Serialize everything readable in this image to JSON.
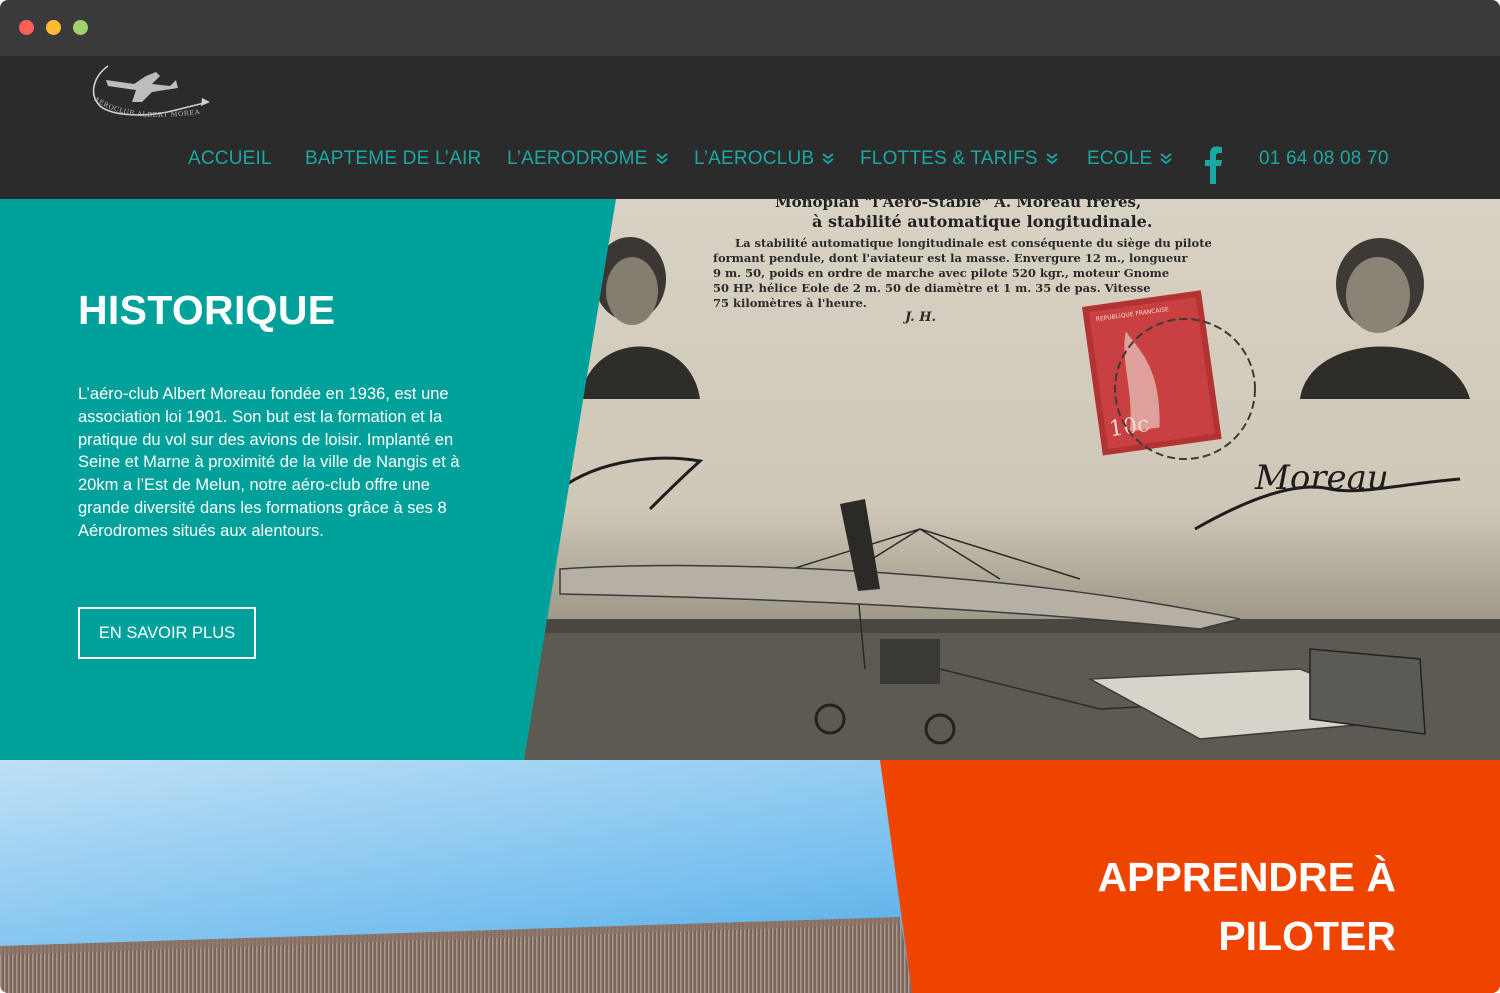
{
  "nav": {
    "items": [
      {
        "label": "ACCUEIL",
        "dropdown": false
      },
      {
        "label": "BAPTEME DE L’AIR",
        "dropdown": false
      },
      {
        "label": "L’AERODROME",
        "dropdown": true
      },
      {
        "label": "L’AEROCLUB",
        "dropdown": true
      },
      {
        "label": "FLOTTES & TARIFS",
        "dropdown": true
      },
      {
        "label": "ECOLE",
        "dropdown": true
      }
    ],
    "social_icon": "facebook-icon",
    "phone": "01 64 08 08 70"
  },
  "logo": {
    "text": "AEROCLUB ALBERT MOREAU"
  },
  "historique": {
    "title": "HISTORIQUE",
    "body": "L’aéro-club Albert Moreau fondée en 1936, est une association loi 1901. Son but est la formation et la pratique du vol sur des avions de loisir. Implanté en Seine et Marne à proximité de la ville de Nangis et à 20km a l’Est de Melun, notre aéro-club offre une grande diversité dans les formations grâce à ses 8 Aérodromes situés aux alentours.",
    "button_label": "EN SAVOIR PLUS",
    "postcard": {
      "headline_1": "Monoplan \"l'Aéro-Stable\" A. Moreau frères,",
      "headline_2": "à stabilité automatique longitudinale.",
      "caption": "La stabilité automatique longitudinale est conséquente du siège du pilote formant pendule, dont l'aviateur est la masse. Envergure 12 m., longueur 9 m. 50, poids en ordre de marche avec pilote 520 kgr., moteur Gnome 50 HP. hélice Eole de 2 m. 50 de diamètre et 1 m. 35 de pas. Vitesse 75 kilomètres à l'heure.",
      "initials": "J. H.",
      "stamp_value": "10c",
      "stamp_text": "REPUBLIQUE FRANCAISE",
      "signature": "Moreau"
    }
  },
  "piloter": {
    "title_line1": "APPRENDRE À",
    "title_line2": "PILOTER"
  },
  "colors": {
    "chrome": "#3a3a3a",
    "header": "#2b2b2b",
    "nav_text": "#1aa8a3",
    "teal": "#00a19b",
    "orange": "#ee4400",
    "sky": "#3ea4e8"
  }
}
